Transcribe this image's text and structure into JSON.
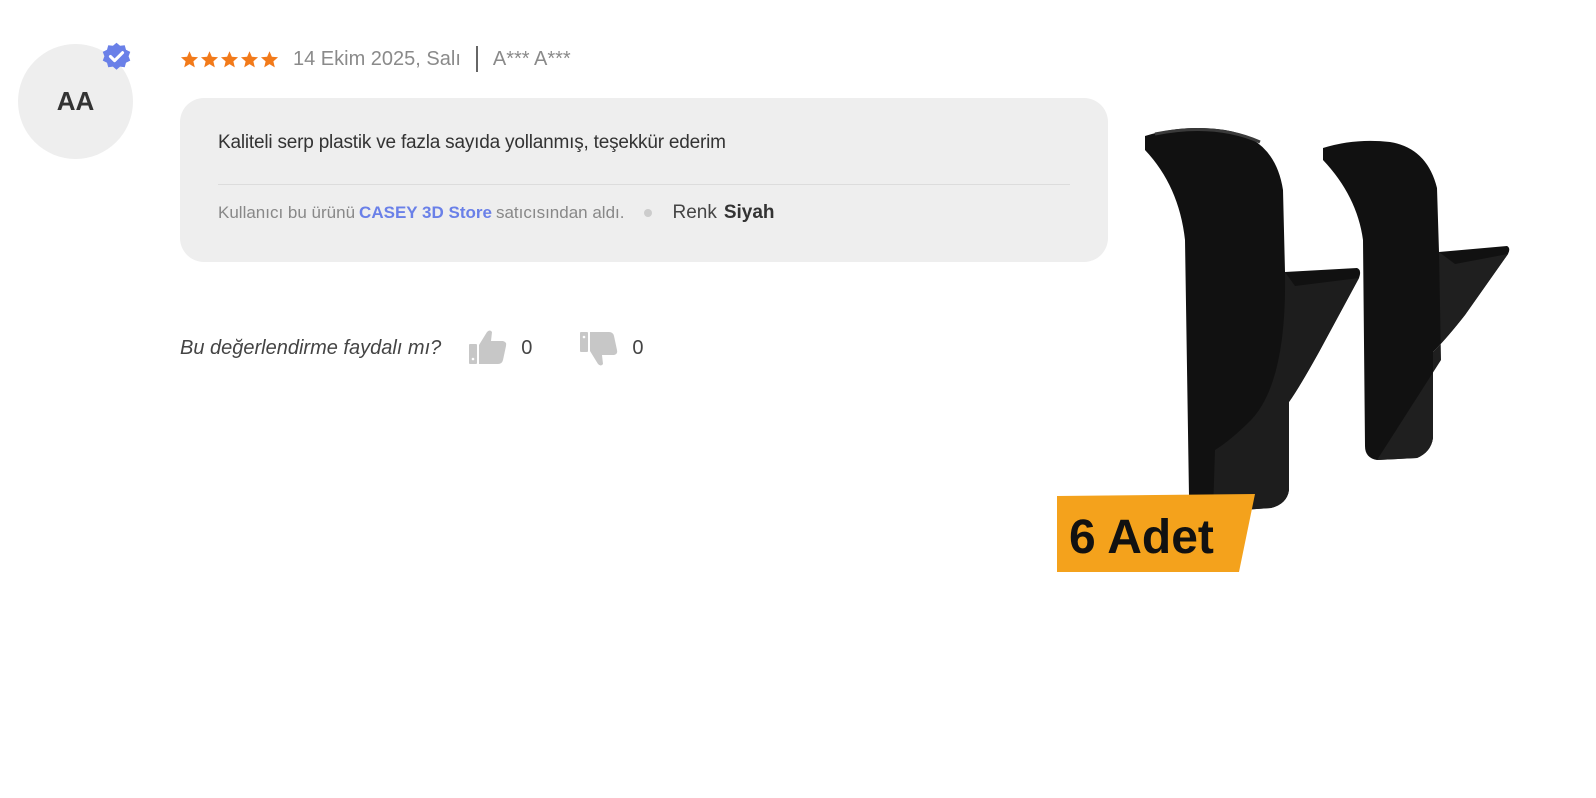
{
  "review": {
    "avatar_initials": "AA",
    "verified_icon": "verified-badge-icon",
    "rating": 5,
    "rating_max": 5,
    "date": "14 Ekim 2025, Salı",
    "reviewer": "A*** A***",
    "comment": "Kaliteli serp plastik ve fazla sayıda yollanmış, teşekkür ederim",
    "seller_prefix": "Kullanıcı bu ürünü",
    "seller_name": "CASEY 3D Store",
    "seller_suffix": "satıcısından aldı.",
    "variant_label": "Renk",
    "variant_value": "Siyah"
  },
  "helpful": {
    "question": "Bu değerlendirme faydalı mı?",
    "up_count": "0",
    "down_count": "0",
    "up_icon": "thumbs-up-icon",
    "down_icon": "thumbs-down-icon"
  },
  "product_image": {
    "badge_text": "6 Adet"
  },
  "colors": {
    "star": "#f27a1a",
    "verified": "#6a80e8",
    "seller_link": "#6a80e8",
    "bubble_bg": "#eeeeee",
    "badge": "#f4a21c"
  }
}
